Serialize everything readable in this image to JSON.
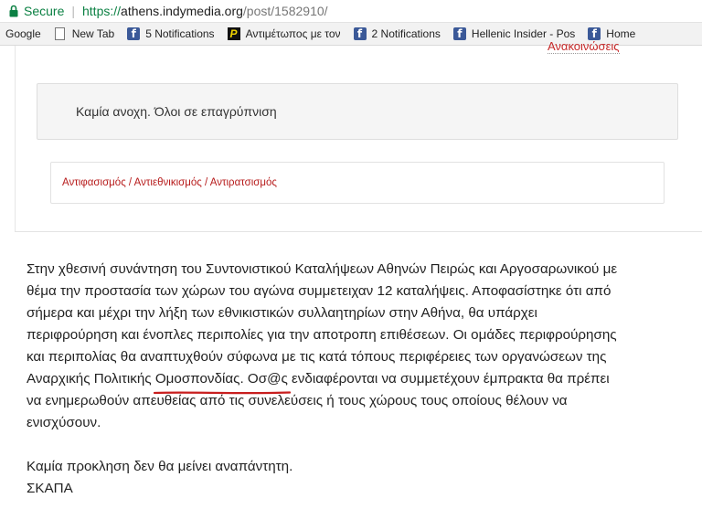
{
  "browser": {
    "secure_label": "Secure",
    "url_protocol": "https://",
    "url_host": "athens.indymedia.org",
    "url_path": "/post/1582910/"
  },
  "bookmarks": [
    {
      "label": "Google",
      "icon": "none"
    },
    {
      "label": "New Tab",
      "icon": "page-icon"
    },
    {
      "label": "5 Notifications",
      "icon": "facebook-icon"
    },
    {
      "label": "Αντιμέτωπος με τον",
      "icon": "p-logo-icon"
    },
    {
      "label": "2 Notifications",
      "icon": "facebook-icon"
    },
    {
      "label": "Hellenic Insider - Pos",
      "icon": "facebook-icon"
    },
    {
      "label": "Home",
      "icon": "facebook-icon"
    }
  ],
  "page": {
    "top_link": "Ανακοινώσεις",
    "subtitle": "Καμία ανοχη. Όλοι σε επαγρύπνιση",
    "tags": "Αντιφασισμός / Αντιεθνικισμός / Αντιρατσισμός",
    "article_lines": [
      "Στην χθεσινή συνάντηση του Συντονιστικού Καταλήψεων Αθηνών Πειρώς και Αργοσαρωνικού με",
      "θέμα την προστασία των χώρων του αγώνα συμμετειχαν 12 καταλήψεις. Αποφασίστηκε ότι από",
      "σήμερα και  μέχρι την λήξη των εθνικιστικών συλλαητηρίων στην Αθήνα, θα υπάρχει",
      "περιφρούρηση και ένοπλες περιπολίες για την αποτροπη επιθέσεων. Οι ομάδες περιφρούρησης",
      "και περιπολίας θα αναπτυχθούν σύφωνα με τις κατά τόπους περιφέρειες των οργανώσεων της",
      "Αναρχικής Πολιτικής Ομοσπονδίας. Οσ@ς ενδιαφέρονται να συμμετέχουν έμπρακτα θα πρέπει",
      "να ενημερωθούν απευθείας από τις συνελεύσεις ή τους χώρους τους οποίους θέλουν να",
      "ενισχύσουν."
    ],
    "closing_line": "Καμία προκληση δεν θα μείνει αναπάντητη.",
    "signature": "ΣΚΑΠΑ"
  },
  "colors": {
    "secure_green": "#0b8043",
    "link_red": "#b71c1c",
    "annotation_red": "#c81e1e"
  }
}
